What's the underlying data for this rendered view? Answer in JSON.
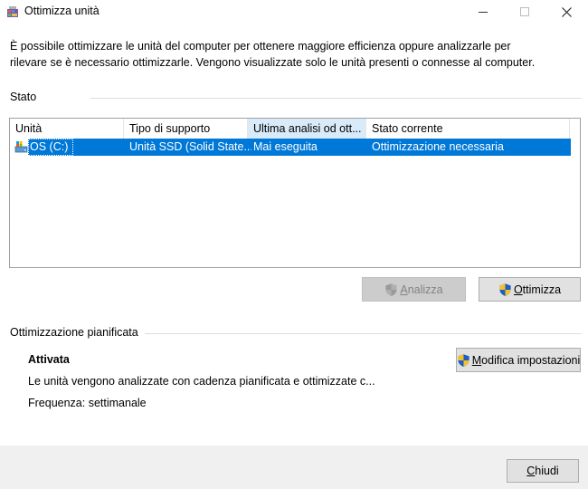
{
  "window": {
    "title": "Ottimizza unità",
    "minimize": "—",
    "maximize": "☐",
    "close": "✕"
  },
  "description": {
    "line1": "È possibile ottimizzare le unità del computer per ottenere maggiore efficienza oppure analizzarle per",
    "line2": "rilevare se è necessario ottimizzarle. Vengono visualizzate solo le unità presenti o connesse al computer."
  },
  "status": {
    "label": "Stato",
    "columns": [
      "Unità",
      "Tipo di supporto",
      "Ultima analisi od ott...",
      "Stato corrente"
    ],
    "rows": [
      {
        "drive": "OS (C:)",
        "media_type": "Unità SSD (Solid State...",
        "last_run": "Mai eseguita",
        "current_status": "Ottimizzazione necessaria",
        "icon": "drive-icon",
        "selected": true
      }
    ],
    "analyze_button": {
      "mnemonic": "A",
      "rest": "nalizza",
      "enabled": false
    },
    "optimize_button": {
      "mnemonic": "O",
      "rest": "ttimizza",
      "enabled": true
    }
  },
  "scheduled": {
    "label": "Ottimizzazione pianificata",
    "state": "Attivata",
    "detail": "Le unità vengono analizzate con cadenza pianificata e ottimizzate c...",
    "frequency": "Frequenza: settimanale",
    "change_settings_button": {
      "mnemonic": "M",
      "rest": "odifica impostazioni"
    }
  },
  "footer": {
    "close_button": {
      "mnemonic": "C",
      "rest": "hiudi"
    }
  },
  "colors": {
    "selection": "#0078d7",
    "sorted_column": "#d9ebf9",
    "footer_bg": "#f0f0f0"
  }
}
